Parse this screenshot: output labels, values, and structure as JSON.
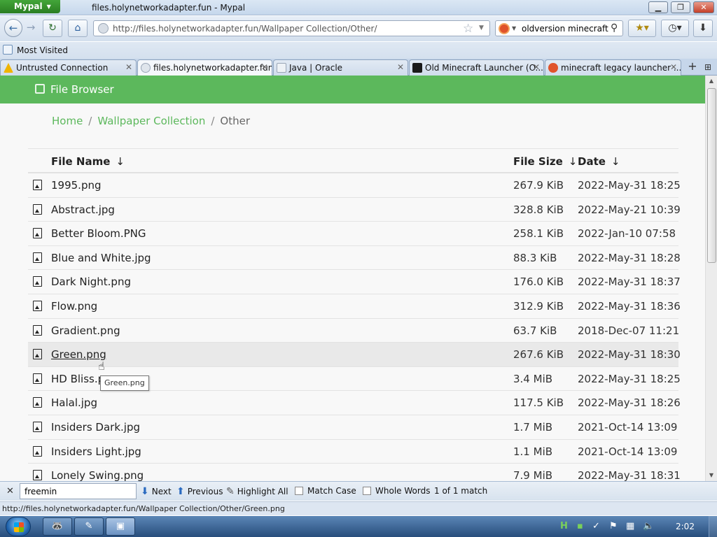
{
  "window": {
    "app_menu": "Mypal",
    "title": "files.holynetworkadapter.fun - Mypal",
    "controls": {
      "minimize": "▁",
      "maximize": "❐",
      "close": "✕"
    }
  },
  "navigation": {
    "url": "http://files.holynetworkadapter.fun/Wallpaper Collection/Other/",
    "search_query": "oldversion minecraft",
    "back_icon": "back-arrow-icon",
    "forward_icon": "forward-arrow-icon"
  },
  "bookmarks": {
    "most_visited": "Most Visited"
  },
  "tabs": [
    {
      "label": "Untrusted Connection",
      "icon_color": "#f0b400",
      "active": false
    },
    {
      "label": "files.holynetworkadapter.fun",
      "icon_color": "#9aa6b6",
      "active": true
    },
    {
      "label": "Java | Oracle",
      "icon_color": "#d7dfe8",
      "active": false
    },
    {
      "label": "Old Minecraft Launcher (O...",
      "icon_color": "#1a1a1a",
      "active": false
    },
    {
      "label": "minecraft legacy launcher ...",
      "icon_color": "#e0532b",
      "active": false
    }
  ],
  "page": {
    "header_title": "File Browser",
    "brand_color": "#5cb85c",
    "breadcrumb": {
      "home": "Home",
      "collection": "Wallpaper Collection",
      "current": "Other",
      "separator": "/"
    },
    "columns": {
      "name": "File Name",
      "size": "File Size",
      "date": "Date",
      "sort_indicator": "↓"
    },
    "files": [
      {
        "name": "1995.png",
        "size": "267.9 KiB",
        "date": "2022-May-31 18:25"
      },
      {
        "name": "Abstract.jpg",
        "size": "328.8 KiB",
        "date": "2022-May-21 10:39"
      },
      {
        "name": "Better Bloom.PNG",
        "size": "258.1 KiB",
        "date": "2022-Jan-10 07:58"
      },
      {
        "name": "Blue and White.jpg",
        "size": "88.3 KiB",
        "date": "2022-May-31 18:28"
      },
      {
        "name": "Dark Night.png",
        "size": "176.0 KiB",
        "date": "2022-May-31 18:37"
      },
      {
        "name": "Flow.png",
        "size": "312.9 KiB",
        "date": "2022-May-31 18:36"
      },
      {
        "name": "Gradient.png",
        "size": "63.7 KiB",
        "date": "2018-Dec-07 11:21"
      },
      {
        "name": "Green.png",
        "size": "267.6 KiB",
        "date": "2022-May-31 18:30"
      },
      {
        "name": "HD Bliss.p",
        "size": "3.4 MiB",
        "date": "2022-May-31 18:25"
      },
      {
        "name": "Halal.jpg",
        "size": "117.5 KiB",
        "date": "2022-May-31 18:26"
      },
      {
        "name": "Insiders Dark.jpg",
        "size": "1.7 MiB",
        "date": "2021-Oct-14 13:09"
      },
      {
        "name": "Insiders Light.jpg",
        "size": "1.1 MiB",
        "date": "2021-Oct-14 13:09"
      },
      {
        "name": "Lonely Swing.png",
        "size": "7.9 MiB",
        "date": "2022-May-31 18:31"
      }
    ],
    "tooltip": "Green.png"
  },
  "find_bar": {
    "query": "freemin",
    "next": "Next",
    "previous": "Previous",
    "highlight_all": "Highlight All",
    "match_case": "Match Case",
    "whole_words": "Whole Words",
    "result": "1 of 1 match"
  },
  "status_bar": {
    "text": "http://files.holynetworkadapter.fun/Wallpaper Collection/Other/Green.png"
  },
  "taskbar": {
    "clock": "2:02"
  }
}
